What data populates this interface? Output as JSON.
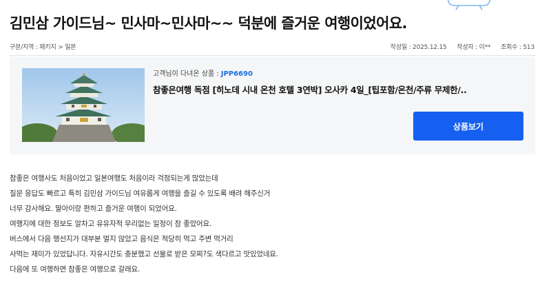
{
  "review": {
    "title": "김민삼 가이드님~ 민사마~민사마~~ 덕분에 즐거운 여행이었어요.",
    "category": "구분/지역 : 패키지 > 일본",
    "date": "작성일 : 2025.12.15",
    "author": "작성자 : 이**",
    "views": "조회수 : 513"
  },
  "product": {
    "label": "고객님이 다녀온 상품 :",
    "code": "JPP6690",
    "name": "참좋은여행 독점 [히노데 시내 온천 호텔 3연박] 오사카 4일_[팁포함/온천/주류 무제한/..",
    "button_label": "상품보기",
    "image_icon": "osaka-castle-photo"
  },
  "body_lines": [
    "참좋은 여행사도 처음이었고 일본여행도 처음이라 걱정되는게 많았는데",
    "질문 응답도 빠르고 특히  김민삼 가이드님 여유롭게 여행을 즐길 수 있도록 배려 해주신거",
    "너무 감사해요. 딸아이랑 편하고 즐거운 여행이 되었어요.",
    "여행지에 대한 정보도 알차고  유유자적 무리없는 일정이 참 좋았어요.",
    "버스에서 다음 행선지가 대부분 멀지 않았고 음식은 적당히 먹고 주변 먹거리",
    "사먹는 재미가 있었답니다.  자유시간도 충분했고 선물로 받은 모찌?도 색다르고 맛있었네요.",
    "다음에 또 여행하면 참좋은 여행으로 갈래요."
  ],
  "colors": {
    "accent": "#1560f0",
    "code_blue": "#1a6fe0",
    "product_bg": "#f5f6f7"
  }
}
